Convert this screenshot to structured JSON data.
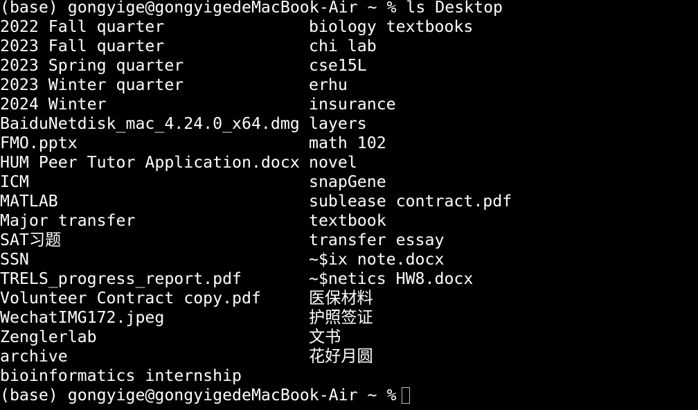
{
  "prompt": {
    "env": "(base)",
    "user_host": "gongyige@gongyigedeMacBook-Air",
    "cwd": "~",
    "symbol": "%"
  },
  "command": "ls Desktop",
  "listing": {
    "left": [
      "2022 Fall quarter",
      "2023 Fall quarter",
      "2023 Spring quarter",
      "2023 Winter quarter",
      "2024 Winter",
      "BaiduNetdisk_mac_4.24.0_x64.dmg",
      "FMO.pptx",
      "HUM Peer Tutor Application.docx",
      "ICM",
      "MATLAB",
      "Major transfer",
      "SAT习题",
      "SSN",
      "TRELS_progress_report.pdf",
      "Volunteer Contract copy.pdf",
      "WechatIMG172.jpeg",
      "Zenglerlab",
      "archive",
      "bioinformatics internship"
    ],
    "right": [
      "biology textbooks",
      "chi lab",
      "cse15L",
      "erhu",
      "insurance",
      "layers",
      "math 102",
      "novel",
      "snapGene",
      "sublease contract.pdf",
      "textbook",
      "transfer essay",
      "~$ix note.docx",
      "~$netics HW8.docx",
      "医保材料",
      "护照签证",
      "文书",
      "花好月圆",
      ""
    ]
  },
  "colors": {
    "background": "#000000",
    "text": "#ffffff",
    "cursor": "#bfbfbf"
  }
}
